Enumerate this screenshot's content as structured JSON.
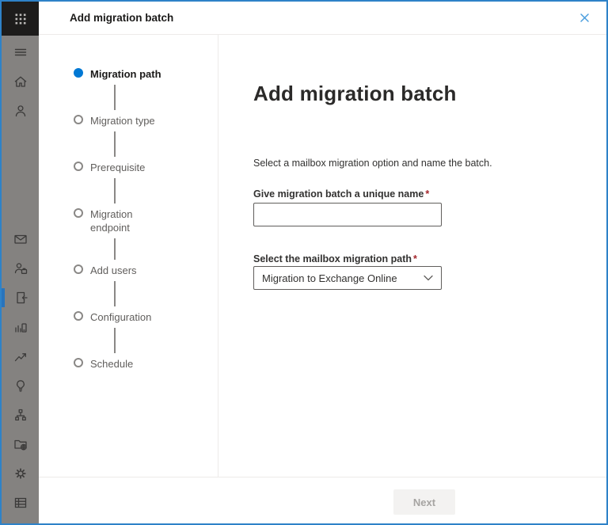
{
  "header": {
    "title": "Add migration batch",
    "close_icon": "close-icon"
  },
  "rail": {
    "app_launcher_icon": "waffle-icon",
    "top_icons": [
      "menu-icon",
      "home-icon",
      "person-icon"
    ],
    "bottom_icons": [
      "mail-icon",
      "recipients-icon",
      "migration-icon",
      "mobile-icon",
      "reports-icon",
      "insights-icon",
      "org-icon",
      "public-folders-icon",
      "settings-icon",
      "other-icon"
    ],
    "selected_icon": "migration-icon"
  },
  "wizard": {
    "steps": [
      {
        "label": "Migration path",
        "state": "active"
      },
      {
        "label": "Migration type",
        "state": "upcoming"
      },
      {
        "label": "Prerequisite",
        "state": "upcoming"
      },
      {
        "label": "Migration endpoint",
        "state": "upcoming"
      },
      {
        "label": "Add users",
        "state": "upcoming"
      },
      {
        "label": "Configuration",
        "state": "upcoming"
      },
      {
        "label": "Schedule",
        "state": "upcoming"
      }
    ]
  },
  "main": {
    "title": "Add migration batch",
    "description": "Select a mailbox migration option and name the batch.",
    "fields": {
      "name": {
        "label": "Give migration batch a unique name",
        "required_marker": "*",
        "value": "",
        "placeholder": ""
      },
      "path": {
        "label": "Select the mailbox migration path",
        "required_marker": "*",
        "selected_option": "Migration to Exchange Online"
      }
    }
  },
  "footer": {
    "next_label": "Next",
    "next_disabled": true
  },
  "colors": {
    "accent": "#0078d4",
    "required_asterisk": "#a4262c",
    "window_border": "#2e82c8",
    "close_icon": "#4a9ede",
    "rail_background": "#848280",
    "selected_indicator": "#2874bd"
  }
}
